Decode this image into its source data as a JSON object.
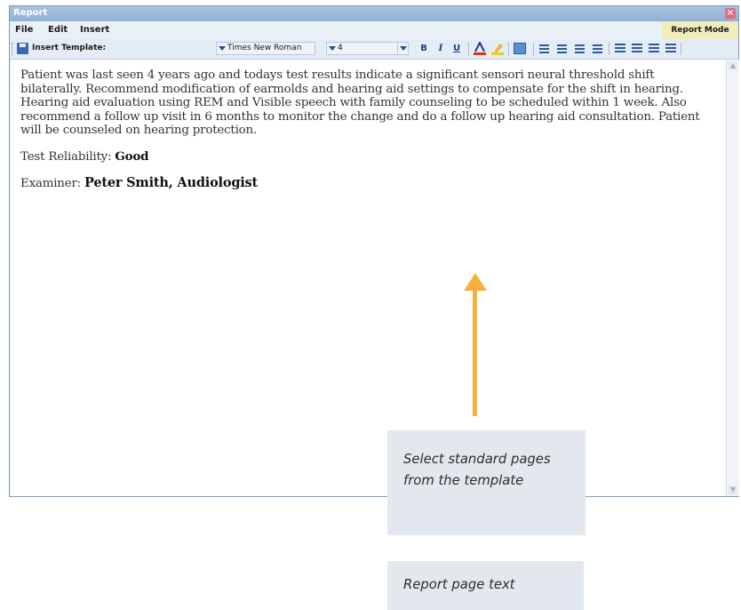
{
  "window": {
    "title": "Report"
  },
  "menu": {
    "file": "File",
    "edit": "Edit",
    "insert": "Insert",
    "mode": "Report Mode"
  },
  "toolbar": {
    "insert_template_label": "Insert Template:",
    "font_family": "Times New Roman",
    "font_size": "4",
    "bold": "B",
    "italic": "I",
    "underline": "U"
  },
  "document": {
    "paragraph": "Patient was last seen 4 years ago and  todays test results indicate a significant sensori neural threshold shift bilaterally.  Recommend modification of earmolds and hearing aid settings to compensate for the shift in hearing.  Hearing aid evaluation using REM and Visible speech with family counseling to be scheduled within 1 week. Also recommend a follow up visit in 6 months to monitor the change and do a follow up hearing aid consultation.  Patient will be counseled on hearing protection.",
    "reliability_label": "Test Reliability: ",
    "reliability_value": "Good",
    "examiner_label": "Examiner:  ",
    "examiner_value": "Peter Smith, Audiologist"
  },
  "callouts": {
    "template": "Select standard pages from the template",
    "report_text": "Report page text"
  },
  "colors": {
    "arrow": "#f6b13c",
    "callout_bg": "#e2e8ee",
    "report_mode_bg": "#f2ecb9"
  }
}
